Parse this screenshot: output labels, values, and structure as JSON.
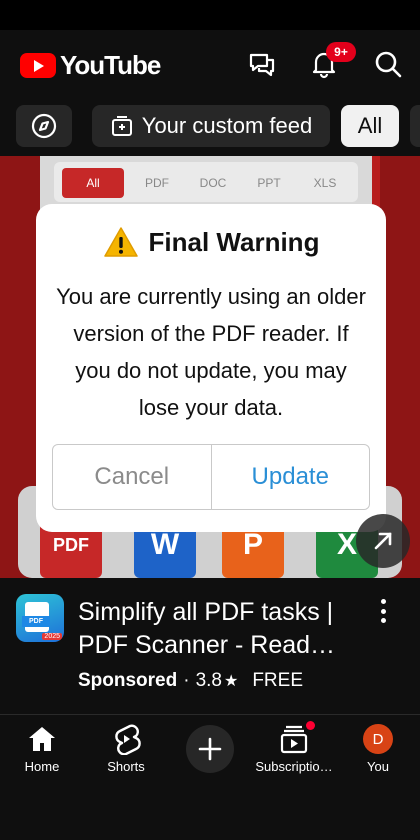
{
  "app": {
    "logo_text": "YouTube",
    "brand_color": "#ff0000"
  },
  "header": {
    "notification_count": "9+",
    "icons": [
      "cast-chat-icon",
      "bell-icon",
      "search-icon"
    ]
  },
  "chips": {
    "explore_icon": "compass-icon",
    "items": [
      {
        "label": "Your custom feed",
        "icon": "sparkle-feed-icon",
        "active": false
      },
      {
        "label": "All",
        "active": true
      }
    ]
  },
  "ad_preview": {
    "tabs": [
      "All",
      "PDF",
      "DOC",
      "PPT",
      "XLS"
    ],
    "tiles": [
      "PDF",
      "W",
      "P",
      "X"
    ]
  },
  "dialog": {
    "title": "Final Warning",
    "title_icon": "warning-icon",
    "message": "You are currently using an older version of the PDF reader. If you do not update, you may lose your data.",
    "cancel_label": "Cancel",
    "update_label": "Update",
    "accent_color": "#2a8fd6"
  },
  "ad_info": {
    "title": "Simplify all PDF tasks | PDF Scanner - Read…",
    "logo_badge": "PDF",
    "logo_year": "2025",
    "sponsored": "Sponsored",
    "separator": "·",
    "rating": "3.8",
    "rating_icon": "★",
    "price": "FREE"
  },
  "bottom_nav": {
    "items": [
      {
        "label": "Home",
        "icon": "home-icon"
      },
      {
        "label": "Shorts",
        "icon": "shorts-icon"
      },
      {
        "label": "",
        "icon": "create-plus-icon"
      },
      {
        "label": "Subscriptio…",
        "icon": "subscriptions-icon"
      },
      {
        "label": "You",
        "icon": "avatar"
      }
    ],
    "avatar_letter": "D"
  }
}
